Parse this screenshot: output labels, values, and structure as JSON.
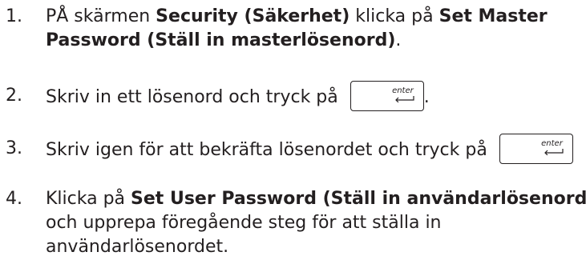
{
  "steps": [
    {
      "number": "1.",
      "lines": [
        [
          {
            "t": "PÅ skärmen "
          },
          {
            "t": "Security (Säkerhet)",
            "b": true
          },
          {
            "t": " klicka på "
          },
          {
            "t": "Set Master",
            "b": true
          }
        ],
        [
          {
            "t": "Password (Ställ in masterlösenord)",
            "b": true
          },
          {
            "t": "."
          }
        ]
      ]
    },
    {
      "number": "2.",
      "lines": [
        [
          {
            "t": "Skriv in ett lösenord och tryck på "
          },
          {
            "key": "enter"
          },
          {
            "t": "."
          }
        ]
      ]
    },
    {
      "number": "3.",
      "lines": [
        [
          {
            "t": "Skriv igen för att bekräfta lösenordet och tryck på "
          },
          {
            "key": "enter"
          }
        ]
      ]
    },
    {
      "number": "4.",
      "lines": [
        [
          {
            "t": "Klicka på "
          },
          {
            "t": "Set User Password (Ställ in användarlösenord)",
            "b": true
          }
        ],
        [
          {
            "t": "och upprepa föregående steg för att ställa in"
          }
        ],
        [
          {
            "t": "användarlösenordet."
          }
        ]
      ]
    }
  ],
  "icons": {
    "enter_key": "enter-key-icon"
  }
}
